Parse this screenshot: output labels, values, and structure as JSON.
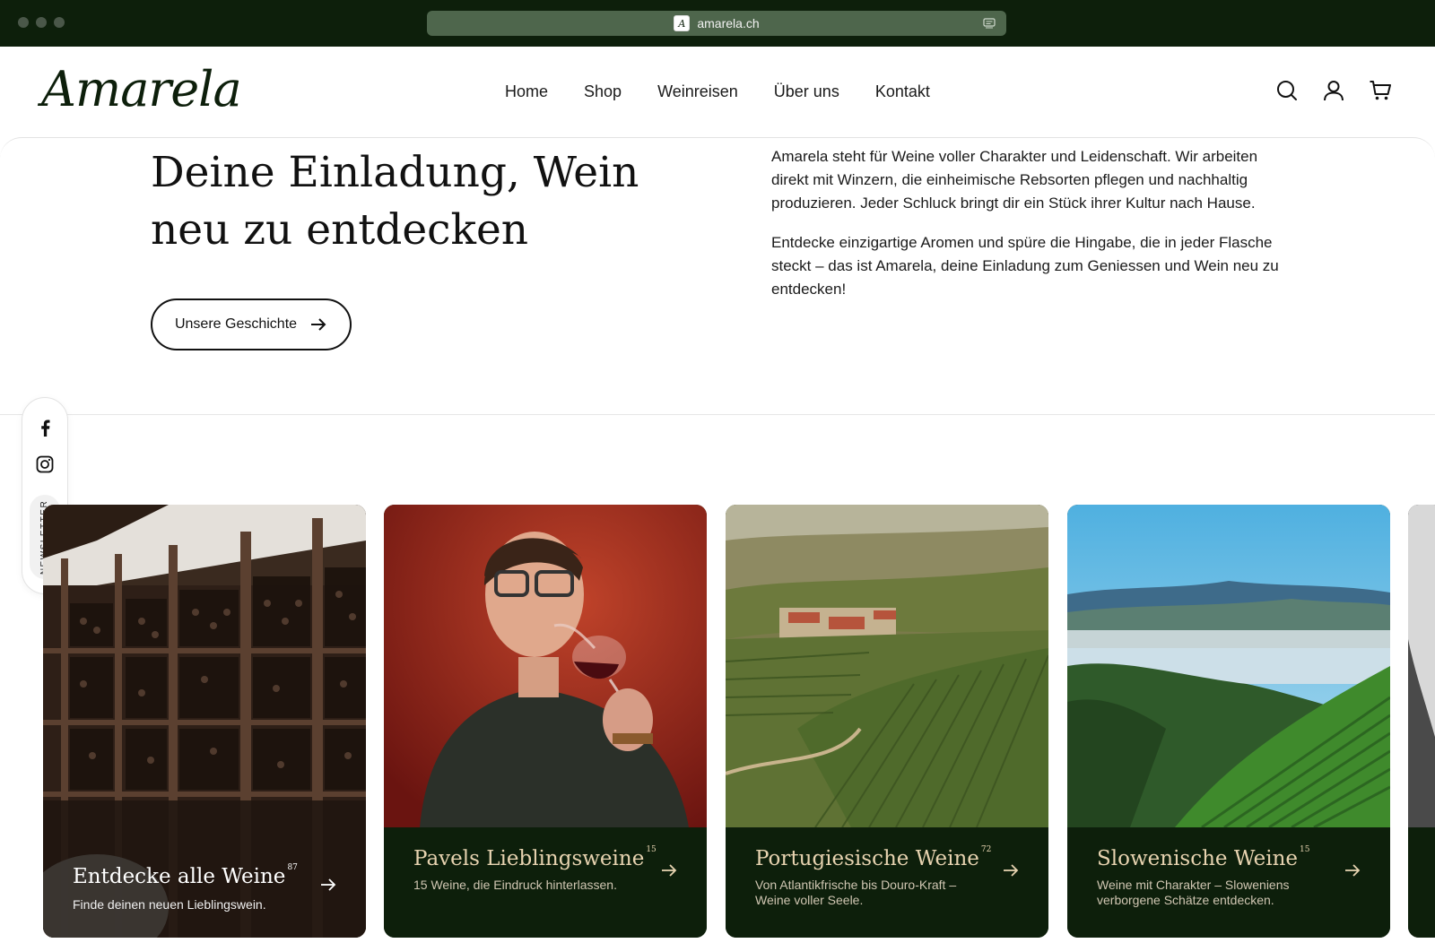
{
  "browser": {
    "url": "amarela.ch"
  },
  "header": {
    "logo": "Amarela",
    "nav": [
      "Home",
      "Shop",
      "Weinreisen",
      "Über uns",
      "Kontakt"
    ],
    "icons": [
      "search-icon",
      "account-icon",
      "cart-icon"
    ]
  },
  "hero": {
    "title_line1": "Deine Einladung, Wein",
    "title_line2": "neu zu entdecken",
    "button_label": "Unsere Geschichte",
    "paragraph1": "Amarela steht für Weine voller Charakter und Leidenschaft. Wir arbeiten direkt mit Winzern, die einheimische Rebsorten pflegen und nachhaltig produzieren. Jeder Schluck bringt dir ein Stück ihrer Kultur nach Hause.",
    "paragraph2": "Entdecke einzigartige Aromen und spüre die Hingabe, die in jeder Flasche steckt – das ist Amarela, deine Einladung zum Geniessen und Wein neu zu entdecken!"
  },
  "social": {
    "icons": [
      "facebook-icon",
      "instagram-icon"
    ],
    "newsletter_label": "NEWSLETTER"
  },
  "cards": [
    {
      "title": "Entdecke alle Weine",
      "count": "87",
      "subtitle": "Finde deinen neuen Lieblingswein."
    },
    {
      "title": "Pavels Lieblingsweine",
      "count": "15",
      "subtitle": "15 Weine, die Eindruck hinterlassen."
    },
    {
      "title": "Portugiesische Weine",
      "count": "72",
      "subtitle": "Von Atlantikfrische bis Douro-Kraft – Weine voller Seele."
    },
    {
      "title": "Slowenische Weine",
      "count": "15",
      "subtitle": "Weine mit Charakter – Sloweniens verborgene Schätze entdecken."
    }
  ],
  "colors": {
    "brand_dark_green": "#0d1f0b",
    "card_title_gold": "#e7d3b0"
  }
}
